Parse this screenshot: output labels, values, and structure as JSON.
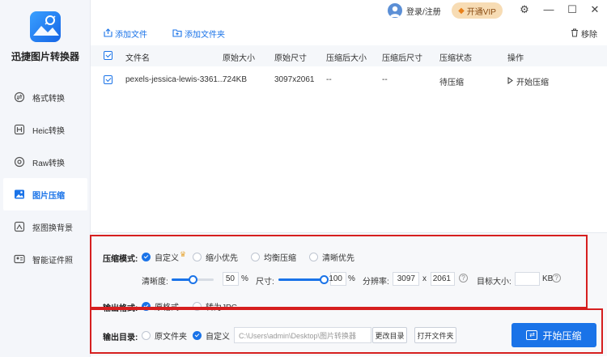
{
  "app": {
    "title": "迅捷图片转换器"
  },
  "sidebar": {
    "items": [
      {
        "label": "格式转换",
        "icon": "format-convert-icon"
      },
      {
        "label": "Heic转换",
        "icon": "heic-icon"
      },
      {
        "label": "Raw转换",
        "icon": "raw-icon"
      },
      {
        "label": "图片压缩",
        "icon": "image-compress-icon",
        "active": true
      },
      {
        "label": "抠图换背景",
        "icon": "cutout-icon"
      },
      {
        "label": "智能证件照",
        "icon": "id-photo-icon"
      }
    ]
  },
  "topbar": {
    "login_label": "登录/注册",
    "vip_label": "开通VIP",
    "controls": {
      "settings": "⚙",
      "minimize": "—",
      "maximize": "☐",
      "close": "✕"
    }
  },
  "toolbar": {
    "add_file": "添加文件",
    "add_folder": "添加文件夹",
    "remove": "移除"
  },
  "table": {
    "columns": [
      "文件名",
      "原始大小",
      "原始尺寸",
      "压缩后大小",
      "压缩后尺寸",
      "压缩状态",
      "操作"
    ],
    "rows": [
      {
        "name": "pexels-jessica-lewis-3361...",
        "orig_size": "724KB",
        "orig_dim": "3097x2061",
        "comp_size": "--",
        "comp_dim": "--",
        "status": "待压缩",
        "action": "开始压缩"
      }
    ]
  },
  "settings": {
    "mode_label": "压缩模式:",
    "modes": [
      {
        "label": "自定义",
        "selected": true
      },
      {
        "label": "缩小优先",
        "selected": false
      },
      {
        "label": "均衡压缩",
        "selected": false
      },
      {
        "label": "清晰优先",
        "selected": false
      }
    ],
    "clarity_label": "清晰度:",
    "clarity_value": "50",
    "clarity_unit": "%",
    "clarity_fraction": 0.5,
    "size_label": "尺寸:",
    "size_value": "100",
    "size_unit": "%",
    "size_fraction": 1.0,
    "resolution_label": "分辨率:",
    "res_w": "3097",
    "res_x": "x",
    "res_h": "2061",
    "target_label": "目标大小:",
    "target_value": "",
    "target_unit": "KB",
    "help": "?",
    "output_format_label": "输出格式:",
    "formats": [
      {
        "label": "原格式",
        "selected": true
      },
      {
        "label": "转为JPG",
        "selected": false
      }
    ],
    "output_dir_label": "输出目录:",
    "dirs": [
      {
        "label": "原文件夹",
        "selected": false
      },
      {
        "label": "自定义",
        "selected": true
      }
    ],
    "path": "C:\\Users\\admin\\Desktop\\图片转换器",
    "change_dir": "更改目录",
    "open_folder": "打开文件夹",
    "start": "开始压缩"
  },
  "colors": {
    "accent": "#1a73e8",
    "highlight_box": "#d61f1f",
    "vip_bg": "#f7dcb4"
  }
}
